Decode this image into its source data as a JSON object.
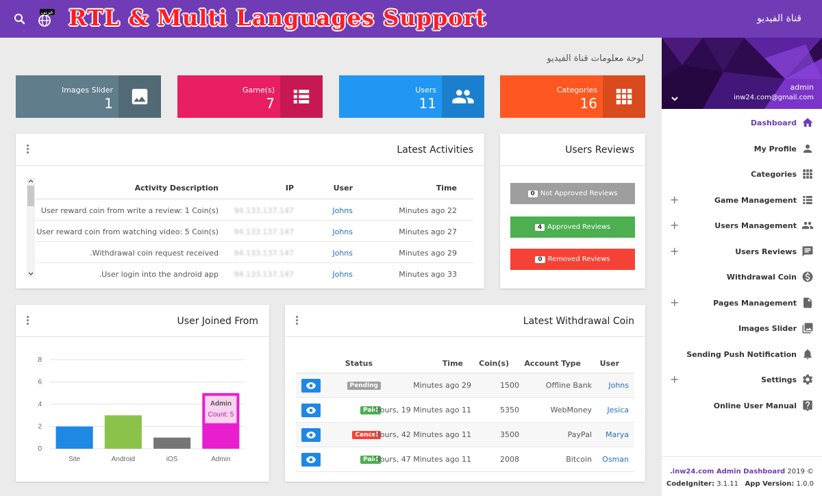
{
  "topbar": {
    "banner": "RTL & Multi Languages Support",
    "brand": "قناة الفيديو",
    "lang_badge": "عربي"
  },
  "page_title": "لوحة معلومات قناة الفيديو",
  "stats": [
    {
      "label": "Images Slider",
      "value": "1",
      "color": "#607d8b",
      "icon": "image-icon"
    },
    {
      "label": "Game(s)",
      "value": "7",
      "color": "#e91e63",
      "icon": "list-icon"
    },
    {
      "label": "Users",
      "value": "11",
      "color": "#2196f3",
      "icon": "people-icon"
    },
    {
      "label": "Categories",
      "value": "16",
      "color": "#ff5722",
      "icon": "grid-icon"
    }
  ],
  "activities": {
    "title": "Latest Activities",
    "headers": {
      "time": "Time",
      "user": "User",
      "ip": "IP",
      "desc": "Activity Description"
    },
    "rows": [
      {
        "time": "Minutes ago 22",
        "user": "Johns",
        "ip": "94.133.137.147",
        "desc": "User reward coin from write a review: 1 Coin(s)"
      },
      {
        "time": "Minutes ago 27",
        "user": "Johns",
        "ip": "94.133.137.147",
        "desc": "User reward coin from watching video: 5 Coin(s)"
      },
      {
        "time": "Minutes ago 29",
        "user": "Johns",
        "ip": "94.133.137.147",
        "desc": ".Withdrawal coin request received"
      },
      {
        "time": "Minutes ago 33",
        "user": "Johns",
        "ip": "94.133.137.147",
        "desc": ".User login into the android app"
      }
    ]
  },
  "reviews": {
    "title": "Users Reviews",
    "buttons": [
      {
        "count": "0",
        "label": "Not Approved Reviews",
        "color": "#9e9e9e"
      },
      {
        "count": "4",
        "label": "Approved Reviews",
        "color": "#4caf50"
      },
      {
        "count": "0",
        "label": "Removed Reviews",
        "color": "#f44336"
      }
    ]
  },
  "joined": {
    "title": "User Joined From",
    "tooltip": {
      "title": "Admin",
      "body": "Count: 5"
    }
  },
  "chart_data": {
    "type": "bar",
    "categories": [
      "Site",
      "Android",
      "iOS",
      "Admin"
    ],
    "values": [
      2,
      3,
      1,
      5
    ],
    "colors": [
      "#1e88e5",
      "#8bc34a",
      "#757575",
      "#e91ecf"
    ],
    "ylim": [
      0,
      8
    ],
    "yticks": [
      0,
      2,
      4,
      6,
      8
    ],
    "grid": true
  },
  "withdrawal": {
    "title": "Latest Withdrawal Coin",
    "headers": {
      "user": "User",
      "account": "Account Type",
      "coins": "Coin(s)",
      "time": "Time",
      "status": "Status"
    },
    "rows": [
      {
        "user": "Johns",
        "account": "Offline Bank",
        "coins": "1500",
        "time": "Minutes ago 29",
        "status": "Pending",
        "status_color": "#9e9e9e"
      },
      {
        "user": "Jesica",
        "account": "WebMoney",
        "coins": "5350",
        "time": "Hours, 19 Minutes ago 11",
        "status": "Paid",
        "status_color": "#4caf50"
      },
      {
        "user": "Marya",
        "account": "PayPal",
        "coins": "3500",
        "time": "Hours, 42 Minutes ago 11",
        "status": "Cancel",
        "status_color": "#f44336"
      },
      {
        "user": "Osman",
        "account": "Bitcoin",
        "coins": "2008",
        "time": "Hours, 47 Minutes ago 11",
        "status": "Paid",
        "status_color": "#4caf50"
      }
    ]
  },
  "sidebar": {
    "user": "admin",
    "email": "inw24.com@gmail.com",
    "items": [
      {
        "label": "Dashboard",
        "icon": "home-icon",
        "expand": false,
        "active": true
      },
      {
        "label": "My Profile",
        "icon": "person-icon",
        "expand": false
      },
      {
        "label": "Categories",
        "icon": "grid-icon",
        "expand": false
      },
      {
        "label": "Game Management",
        "icon": "list-icon",
        "expand": true
      },
      {
        "label": "Users Management",
        "icon": "people-icon",
        "expand": true
      },
      {
        "label": "Users Reviews",
        "icon": "comment-icon",
        "expand": true
      },
      {
        "label": "Withdrawal Coin",
        "icon": "dollar-icon",
        "expand": false
      },
      {
        "label": "Pages Management",
        "icon": "page-icon",
        "expand": true
      },
      {
        "label": "Images Slider",
        "icon": "image-icon",
        "expand": false
      },
      {
        "label": "Sending Push Notification",
        "icon": "bell-icon",
        "expand": false
      },
      {
        "label": "Settings",
        "icon": "gear-icon",
        "expand": true
      },
      {
        "label": "Online User Manual",
        "icon": "help-icon",
        "expand": false
      }
    ],
    "plus_symbol": "+",
    "footer": {
      "copyright": "© 2019",
      "link": "inw24.com Admin Dashboard.",
      "ci_label": "CodeIgniter:",
      "ci_version": "3.1.11",
      "app_label": "App Version:",
      "app_version": "1.0.0"
    }
  }
}
